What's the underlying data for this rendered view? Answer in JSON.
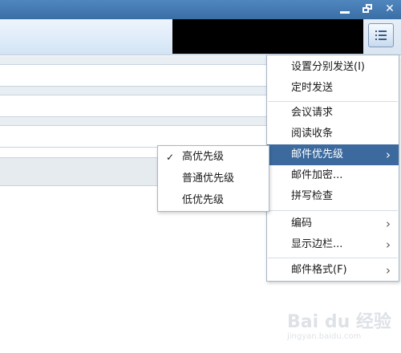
{
  "window_controls": {
    "minimize_icon": "minimize-icon",
    "restore_icon": "restore-icon",
    "close_icon": "close-icon",
    "close_glyph": "✕"
  },
  "toolbar": {
    "menu_button_icon": "list-menu-icon"
  },
  "colors": {
    "titlebar": "#3f77ae",
    "highlight": "#3d6a9e"
  },
  "menu": {
    "items": [
      {
        "label": "设置分别发送(I)"
      },
      {
        "label": "定时发送"
      },
      {
        "label": "会议请求"
      },
      {
        "label": "阅读收条"
      },
      {
        "label": "邮件优先级",
        "arrow": "›",
        "highlighted": true
      },
      {
        "label": "邮件加密..."
      },
      {
        "label": "拼写检查"
      },
      {
        "label": "编码",
        "arrow": "›"
      },
      {
        "label": "显示边栏...",
        "arrow": "›"
      },
      {
        "label": "邮件格式(F)",
        "arrow": "›"
      }
    ]
  },
  "submenu": {
    "items": [
      {
        "label": "高优先级",
        "checked": true,
        "check_glyph": "✓"
      },
      {
        "label": "普通优先级"
      },
      {
        "label": "低优先级"
      }
    ]
  },
  "watermark": {
    "brand": "Bai du 经验",
    "url": "jingyan.baidu.com"
  }
}
